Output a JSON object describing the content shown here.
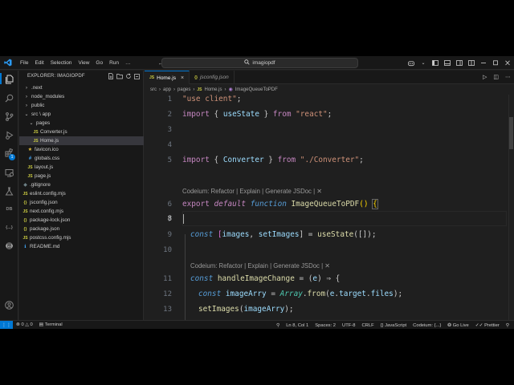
{
  "menu": [
    "File",
    "Edit",
    "Selection",
    "View",
    "Go",
    "Run",
    "…"
  ],
  "command_center": "imagiopdf",
  "explorer": {
    "title": "EXPLORER: IMAGIOPDF",
    "items": [
      {
        "label": ".next",
        "type": "folder",
        "chev": "›"
      },
      {
        "label": "node_modules",
        "type": "folder",
        "chev": "›"
      },
      {
        "label": "public",
        "type": "folder",
        "chev": "›"
      },
      {
        "label": "src \\ app",
        "type": "folder",
        "chev": "⌄"
      },
      {
        "label": "pages",
        "type": "folder",
        "chev": "⌄"
      },
      {
        "label": "Converter.js",
        "type": "js",
        "icon": "JS"
      },
      {
        "label": "Home.js",
        "type": "js",
        "icon": "JS"
      },
      {
        "label": "favicon.ico",
        "type": "star",
        "icon": "★"
      },
      {
        "label": "globals.css",
        "type": "css",
        "icon": "#"
      },
      {
        "label": "layout.js",
        "type": "js",
        "icon": "JS"
      },
      {
        "label": "page.js",
        "type": "js",
        "icon": "JS"
      },
      {
        "label": ".gitignore",
        "type": "git",
        "icon": "◆"
      },
      {
        "label": "eslint.config.mjs",
        "type": "js",
        "icon": "JS"
      },
      {
        "label": "jsconfig.json",
        "type": "json",
        "icon": "{}"
      },
      {
        "label": "next.config.mjs",
        "type": "js",
        "icon": "JS"
      },
      {
        "label": "package-lock.json",
        "type": "json",
        "icon": "{}"
      },
      {
        "label": "package.json",
        "type": "json",
        "icon": "{}"
      },
      {
        "label": "postcss.config.mjs",
        "type": "js",
        "icon": "JS"
      },
      {
        "label": "README.md",
        "type": "md",
        "icon": "ℹ"
      }
    ]
  },
  "tabs": [
    {
      "label": "Home.js",
      "icon": "JS",
      "active": true
    },
    {
      "label": "jsconfig.json",
      "icon": "{}",
      "active": false
    }
  ],
  "breadcrumb": [
    "src",
    "app",
    "pages",
    "Home.js",
    "ImageQueueToPDF"
  ],
  "codelens_text": "Codeium: Refactor | Explain | Generate JSDoc | ✕",
  "code": {
    "line_numbers": [
      "1",
      "2",
      "3",
      "4",
      "5",
      "6",
      "7",
      "8",
      "9",
      "10",
      "11",
      "12",
      "13"
    ],
    "l1_str": "\"use client\"",
    "l1_end": ";",
    "l2_kw": "import",
    "l2_a": " { ",
    "l2_var": "useState",
    "l2_b": " } ",
    "l2_from": "from",
    "l2_sp": " ",
    "l2_str": "\"react\"",
    "l2_end": ";",
    "l5_kw": "import",
    "l5_a": " { ",
    "l5_var": "Converter",
    "l5_b": " } ",
    "l5_from": "from",
    "l5_sp": " ",
    "l5_str": "\"./Converter\"",
    "l5_end": ";",
    "l7_export": "export",
    "l7_default": "default",
    "l7_function": "function",
    "l7_name": "ImageQueueToPDF",
    "l7_paren": "()",
    "l7_brace": "{",
    "l9_const": "const",
    "l9_a": " [",
    "l9_v1": "images",
    "l9_comma": ", ",
    "l9_v2": "setImages",
    "l9_b": "] = ",
    "l9_fn": "useState",
    "l9_c": "([]);",
    "l11_const": "const",
    "l11_sp": " ",
    "l11_fn": "handleImageChange",
    "l11_a": " = (",
    "l11_var": "e",
    "l11_b": ") ⇒ {",
    "l12_const": "const",
    "l12_sp": " ",
    "l12_var": "imageArry",
    "l12_a": " = ",
    "l12_cls": "Array",
    "l12_dot": ".",
    "l12_fn": "from",
    "l12_b": "(",
    "l12_e": "e",
    "l12_c": ".",
    "l12_t": "target",
    "l12_d": ".",
    "l12_f": "files",
    "l12_end": ");",
    "l13_fn": "setImages",
    "l13_a": "(",
    "l13_var": "imageArry",
    "l13_end": ");"
  },
  "status": {
    "errors": "0",
    "warnings": "0",
    "terminal": "Terminal",
    "position": "Ln 8, Col 1",
    "spaces": "Spaces: 2",
    "encoding": "UTF-8",
    "eol": "CRLF",
    "language": "JavaScript",
    "codeium": "Codeium: {...}",
    "golive": "Go Live",
    "prettier": "Prettier"
  },
  "colors": {
    "accent": "#0078d4",
    "keyword": "#c586c0",
    "string": "#ce9178",
    "variable": "#9cdcfe",
    "function": "#dcdcaa",
    "js_icon": "#cbcb41"
  },
  "icons": {
    "activity": [
      "files-icon",
      "search-icon",
      "source-control-icon",
      "run-debug-icon",
      "extensions-icon",
      "remote-explorer-icon",
      "testing-icon",
      "json-icon",
      "account-icon",
      "settings-gear-icon"
    ],
    "extensions_badge": "1",
    "json_label": "{...}",
    "db_label": "DB"
  }
}
